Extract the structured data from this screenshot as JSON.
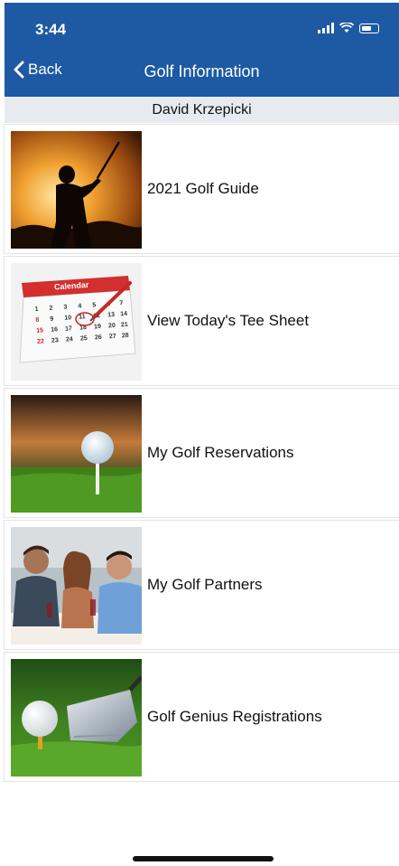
{
  "status_bar": {
    "time": "3:44"
  },
  "navbar": {
    "back_label": "Back",
    "title": "Golf Information"
  },
  "user": {
    "name": "David Krzepicki"
  },
  "menu": [
    {
      "label": "2021 Golf Guide"
    },
    {
      "label": "View Today's Tee Sheet"
    },
    {
      "label": "My Golf Reservations"
    },
    {
      "label": "My Golf Partners"
    },
    {
      "label": "Golf Genius Registrations"
    }
  ],
  "calendar_thumb": {
    "header": "Calendar",
    "numbers": [
      "1",
      "2",
      "3",
      "4",
      "5",
      "6",
      "7",
      "8",
      "9",
      "10",
      "11",
      "12",
      "13",
      "14",
      "15",
      "16",
      "17",
      "18",
      "19",
      "20",
      "21",
      "22",
      "23",
      "24",
      "25",
      "26",
      "27",
      "28"
    ]
  },
  "colors": {
    "header_blue": "#1d5aa3",
    "user_bar": "#e7ebf0"
  }
}
